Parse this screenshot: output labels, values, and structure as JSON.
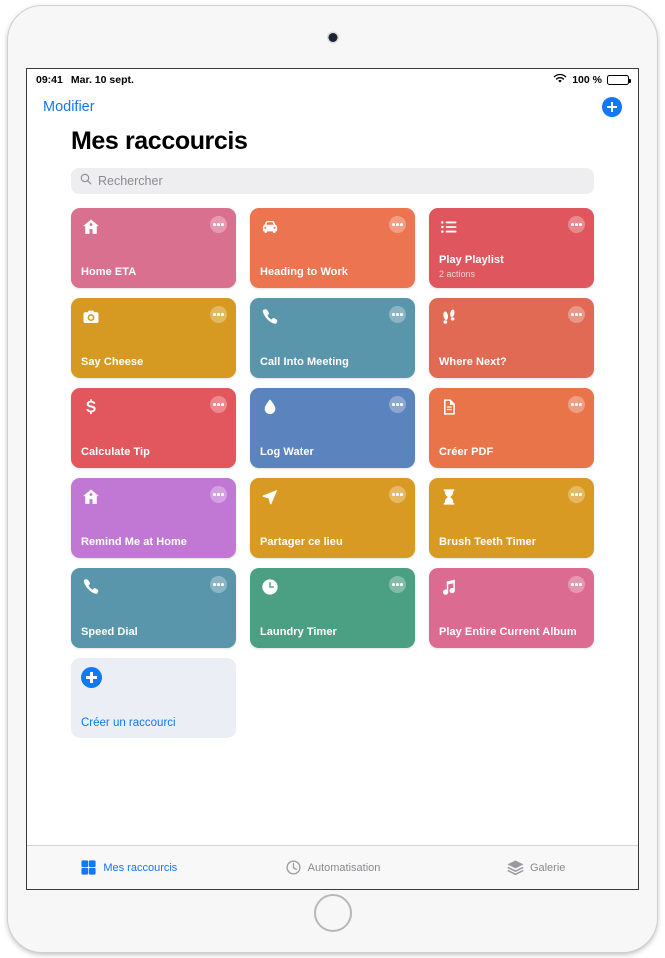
{
  "status_bar": {
    "time": "09:41",
    "date": "Mar. 10 sept.",
    "wifi_icon": "wifi-icon",
    "battery_percent": "100 %",
    "battery_icon": "battery-full-icon"
  },
  "nav": {
    "edit_label": "Modifier",
    "add_icon": "plus-circle-icon"
  },
  "header": {
    "title": "Mes raccourcis"
  },
  "search": {
    "icon": "search-icon",
    "placeholder": "Rechercher"
  },
  "shortcuts": [
    {
      "title": "Home ETA",
      "subtitle": "",
      "icon": "house-icon",
      "color": "#d9708f"
    },
    {
      "title": "Heading to Work",
      "subtitle": "",
      "icon": "car-icon",
      "color": "#ec7450"
    },
    {
      "title": "Play Playlist",
      "subtitle": "2 actions",
      "icon": "list-icon",
      "color": "#e0565e"
    },
    {
      "title": "Say Cheese",
      "subtitle": "",
      "icon": "camera-icon",
      "color": "#d69a22"
    },
    {
      "title": "Call Into Meeting",
      "subtitle": "",
      "icon": "phone-icon",
      "color": "#5a96ab"
    },
    {
      "title": "Where Next?",
      "subtitle": "",
      "icon": "footprints-icon",
      "color": "#e06a54"
    },
    {
      "title": "Calculate Tip",
      "subtitle": "",
      "icon": "dollar-icon",
      "color": "#e2575e"
    },
    {
      "title": "Log Water",
      "subtitle": "",
      "icon": "droplet-icon",
      "color": "#5b83bd"
    },
    {
      "title": "Créer PDF",
      "subtitle": "",
      "icon": "document-icon",
      "color": "#e97449"
    },
    {
      "title": "Remind Me at Home",
      "subtitle": "",
      "icon": "house-icon",
      "color": "#c078d4"
    },
    {
      "title": "Partager ce lieu",
      "subtitle": "",
      "icon": "navigation-icon",
      "color": "#d99a23"
    },
    {
      "title": "Brush Teeth Timer",
      "subtitle": "",
      "icon": "hourglass-icon",
      "color": "#d99a23"
    },
    {
      "title": "Speed Dial",
      "subtitle": "",
      "icon": "phone-icon",
      "color": "#5a96ab"
    },
    {
      "title": "Laundry Timer",
      "subtitle": "",
      "icon": "clock-icon",
      "color": "#4ba083"
    },
    {
      "title": "Play Entire Current Album",
      "subtitle": "",
      "icon": "music-note-icon",
      "color": "#db6b91"
    }
  ],
  "create_card": {
    "label": "Créer un raccourci",
    "icon": "plus-circle-icon"
  },
  "tabs": [
    {
      "label": "Mes raccourcis",
      "icon": "grid-squares-icon",
      "active": true
    },
    {
      "label": "Automatisation",
      "icon": "clock-automation-icon",
      "active": false
    },
    {
      "label": "Galerie",
      "icon": "layers-icon",
      "active": false
    }
  ],
  "colors": {
    "accent_blue": "#1278f3",
    "inactive_gray": "#8a8a8e",
    "search_bg": "#eeeef0",
    "create_card_bg": "#eceef6"
  }
}
